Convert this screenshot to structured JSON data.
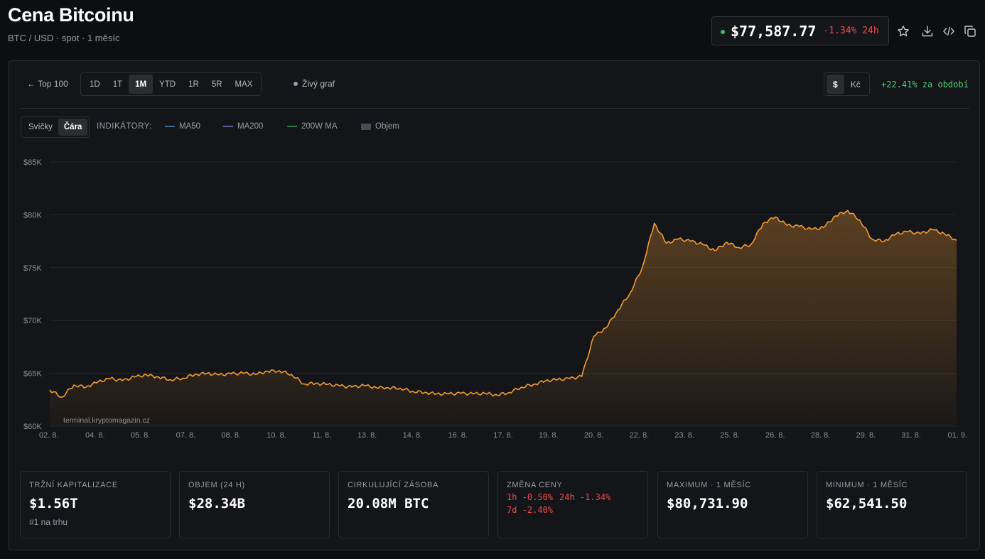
{
  "header": {
    "title": "Cena Bitcoinu",
    "subtitle": "BTC / USD · spot · 1 měsíc",
    "price": "$77,587.77",
    "change_24h": "-1.34% 24h",
    "icons": [
      "star-icon",
      "download-icon",
      "code-icon",
      "copy-icon"
    ]
  },
  "toolbar": {
    "back_label": "← Top 100",
    "ranges": [
      "1D",
      "1T",
      "1M",
      "YTD",
      "1R",
      "5R",
      "MAX"
    ],
    "active_range": "1M",
    "live_chart_label": "Živý graf",
    "currencies": [
      "$",
      "Kč"
    ],
    "active_currency": "$",
    "period_change": "+22.41% za období"
  },
  "indicators": {
    "chart_types": [
      "Svíčky",
      "Čára"
    ],
    "active_type": "Čára",
    "label": "INDIKÁTORY:",
    "items": [
      {
        "name": "MA50",
        "color": "#3a6f8f",
        "kind": "line"
      },
      {
        "name": "MA200",
        "color": "#6a5f96",
        "kind": "line"
      },
      {
        "name": "200W MA",
        "color": "#2f7a4a",
        "kind": "line"
      },
      {
        "name": "Objem",
        "color": "#4a4c51",
        "kind": "box"
      }
    ]
  },
  "colors": {
    "line": "#f29a35",
    "background": "#0d0e10",
    "negative": "#ef4b4b",
    "positive": "#4cd07d"
  },
  "chart_data": {
    "type": "area",
    "watermark": "terminal.kryptomagazin.cz",
    "y_ticks": [
      "$85K",
      "$80K",
      "$75K",
      "$70K",
      "$65K",
      "$60K"
    ],
    "ylim": [
      60000,
      85000
    ],
    "x_ticks": [
      "02. 8.",
      "04. 8.",
      "05. 8.",
      "07. 8.",
      "08. 8.",
      "10. 8.",
      "11. 8.",
      "13. 8.",
      "14. 8.",
      "16. 8.",
      "17. 8.",
      "19. 8.",
      "20. 8.",
      "22. 8.",
      "23. 8.",
      "25. 8.",
      "26. 8.",
      "28. 8.",
      "29. 8.",
      "31. 8.",
      "01. 9."
    ],
    "xlim": [
      0,
      30
    ],
    "grid": true,
    "series": [
      {
        "x": [
          0,
          0.4,
          0.8,
          1.2,
          1.6,
          2,
          2.4,
          2.8,
          3.2,
          3.6,
          4,
          4.4,
          4.8,
          5.2,
          5.6,
          6,
          6.4,
          6.8,
          7.2,
          7.6,
          8,
          8.4,
          8.8,
          9.2,
          9.6,
          10,
          10.4,
          10.8,
          11.2,
          11.6,
          12,
          12.4,
          12.8,
          13.2,
          13.6,
          14,
          14.4,
          14.8,
          15.2,
          15.6,
          16,
          16.4,
          16.8,
          17.2,
          17.6,
          18,
          18.4,
          18.8,
          19.2,
          19.6,
          20,
          20.4,
          20.8,
          21.2,
          21.6,
          22,
          22.4,
          22.8,
          23.2,
          23.6,
          24,
          24.4,
          24.8,
          25.2,
          25.6,
          26,
          26.4,
          26.8,
          27.2,
          27.6,
          28,
          28.4,
          28.8,
          29.2,
          29.6,
          30
        ],
        "values": [
          63450,
          62750,
          63900,
          63700,
          64200,
          64500,
          64300,
          64650,
          64850,
          64650,
          64400,
          64550,
          64900,
          65000,
          64850,
          64950,
          65000,
          64900,
          65200,
          65250,
          64900,
          64000,
          64050,
          63950,
          63800,
          63700,
          63850,
          63650,
          63650,
          63600,
          63300,
          63200,
          63050,
          63050,
          63100,
          63050,
          63100,
          62950,
          63200,
          63700,
          63950,
          64300,
          64400,
          64500,
          64700,
          68500,
          69300,
          71000,
          72600,
          75000,
          79200,
          77300,
          77700,
          77500,
          77200,
          76600,
          77400,
          76900,
          77200,
          79200,
          79800,
          79000,
          78900,
          78600,
          78800,
          79900,
          80400,
          79500,
          77700,
          77500,
          78200,
          78400,
          78200,
          78600,
          78200,
          77590
        ],
        "min": 62541.5,
        "max": 80731.9
      }
    ]
  },
  "stats": [
    {
      "label": "TRŽNÍ KAPITALIZACE",
      "value": "$1.56T",
      "sub": "#1 na trhu"
    },
    {
      "label": "OBJEM (24 H)",
      "value": "$28.34B"
    },
    {
      "label": "CIRKULUJÍCÍ ZÁSOBA",
      "value": "20.08M BTC"
    },
    {
      "label": "ZMĚNA CENY",
      "changes": [
        "1h -0.50%",
        "24h -1.34%",
        "7d -2.40%"
      ]
    },
    {
      "label": "MAXIMUM · 1 MĚSÍC",
      "value": "$80,731.90"
    },
    {
      "label": "MINIMUM · 1 MĚSÍC",
      "value": "$62,541.50"
    }
  ]
}
